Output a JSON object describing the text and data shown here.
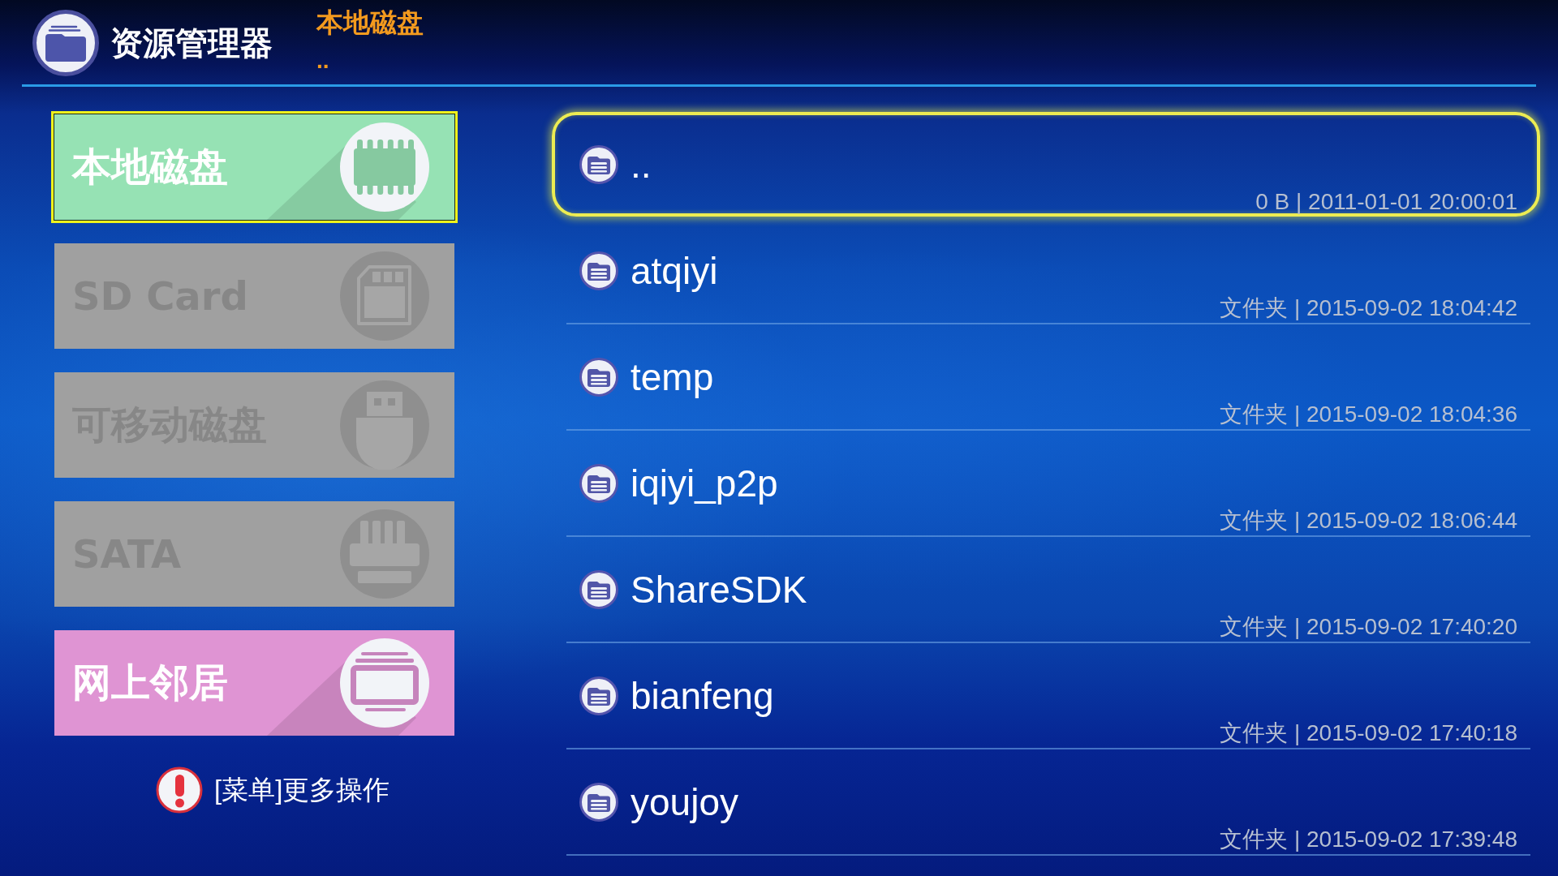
{
  "header": {
    "title": "资源管理器",
    "location": "本地磁盘",
    "path": ".."
  },
  "sidebar": {
    "items": [
      {
        "label": "本地磁盘",
        "color": "#96e2b4",
        "selected": true,
        "disabled": false
      },
      {
        "label": "SD Card",
        "color": "#a0a0a0",
        "selected": false,
        "disabled": true
      },
      {
        "label": "可移动磁盘",
        "color": "#a0a0a0",
        "selected": false,
        "disabled": true
      },
      {
        "label": "SATA",
        "color": "#a0a0a0",
        "selected": false,
        "disabled": true
      },
      {
        "label": "网上邻居",
        "color": "#df94d3",
        "selected": false,
        "disabled": false
      }
    ]
  },
  "hint": "[菜单]更多操作",
  "files": [
    {
      "name": "..",
      "info": "0 B | 2011-01-01 20:00:01",
      "selected": true
    },
    {
      "name": "atqiyi",
      "info": "文件夹 | 2015-09-02 18:04:42",
      "selected": false
    },
    {
      "name": "temp",
      "info": "文件夹 | 2015-09-02 18:04:36",
      "selected": false
    },
    {
      "name": "iqiyi_p2p",
      "info": "文件夹 | 2015-09-02 18:06:44",
      "selected": false
    },
    {
      "name": "ShareSDK",
      "info": "文件夹 | 2015-09-02 17:40:20",
      "selected": false
    },
    {
      "name": "bianfeng",
      "info": "文件夹 | 2015-09-02 17:40:18",
      "selected": false
    },
    {
      "name": "youjoy",
      "info": "文件夹 | 2015-09-02 17:39:48",
      "selected": false
    }
  ]
}
